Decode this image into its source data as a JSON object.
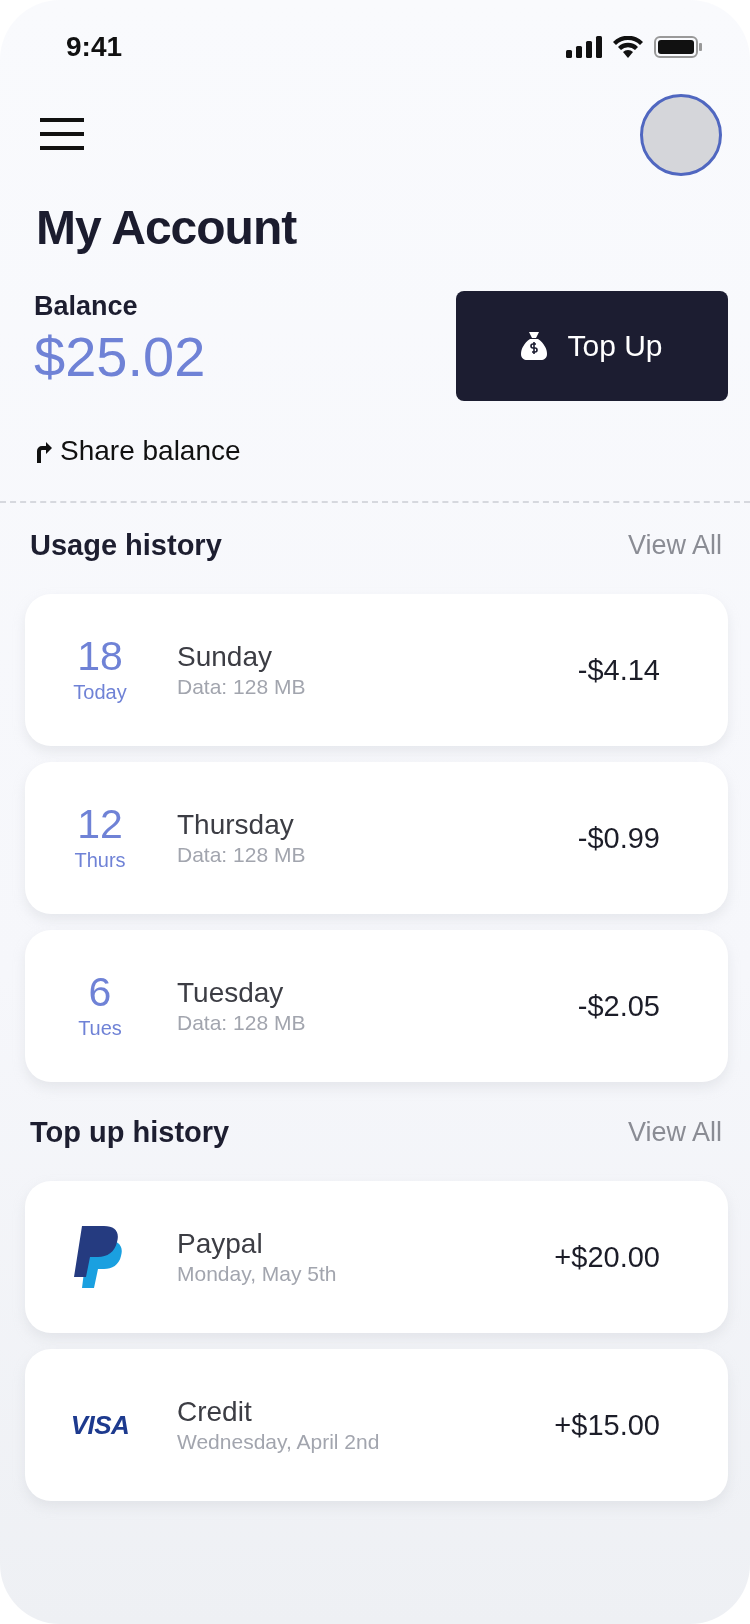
{
  "status_bar": {
    "time": "9:41"
  },
  "header": {
    "title": "My Account"
  },
  "balance": {
    "label": "Balance",
    "amount": "$25.02",
    "button": "Top Up",
    "share": "Share balance"
  },
  "usage_history": {
    "title": "Usage history",
    "view_all": "View All",
    "items": [
      {
        "day": "18",
        "day_label": "Today",
        "title": "Sunday",
        "detail": "Data: 128 MB",
        "amount": "-$4.14"
      },
      {
        "day": "12",
        "day_label": "Thurs",
        "title": "Thursday",
        "detail": "Data: 128 MB",
        "amount": "-$0.99"
      },
      {
        "day": "6",
        "day_label": "Tues",
        "title": "Tuesday",
        "detail": "Data: 128 MB",
        "amount": "-$2.05"
      }
    ]
  },
  "topup_history": {
    "title": "Top up history",
    "view_all": "View All",
    "items": [
      {
        "kind": "paypal",
        "title": "Paypal",
        "detail": "Monday, May 5th",
        "amount": "+$20.00"
      },
      {
        "kind": "visa",
        "logo_text": "VISA",
        "title": "Credit",
        "detail": "Wednesday, April 2nd",
        "amount": "+$15.00"
      }
    ]
  }
}
